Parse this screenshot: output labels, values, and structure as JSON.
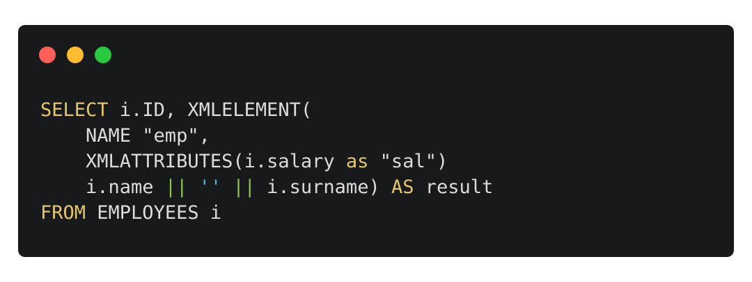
{
  "window": {
    "controls": [
      {
        "name": "close",
        "color": "#ff5f57"
      },
      {
        "name": "minimize",
        "color": "#febc2e"
      },
      {
        "name": "zoom",
        "color": "#28c840"
      }
    ]
  },
  "colors": {
    "background": "#18191b",
    "text": "#dcdcdc",
    "keyword": "#e5c76b",
    "operator": "#8bc34a",
    "string_literal": "#4fb3d9"
  },
  "code": {
    "lines": [
      [
        {
          "text": "SELECT",
          "type": "keyword"
        },
        {
          "text": " i.ID, XMLELEMENT(",
          "type": "text"
        }
      ],
      [
        {
          "text": "    NAME \"emp\",",
          "type": "text"
        }
      ],
      [
        {
          "text": "    XMLATTRIBUTES(i.salary ",
          "type": "text"
        },
        {
          "text": "as",
          "type": "keyword"
        },
        {
          "text": " \"sal\")",
          "type": "text"
        }
      ],
      [
        {
          "text": "    i.name ",
          "type": "text"
        },
        {
          "text": "||",
          "type": "operator"
        },
        {
          "text": " ",
          "type": "text"
        },
        {
          "text": "''",
          "type": "string_literal"
        },
        {
          "text": " ",
          "type": "text"
        },
        {
          "text": "||",
          "type": "operator"
        },
        {
          "text": " i.surname) ",
          "type": "text"
        },
        {
          "text": "AS",
          "type": "keyword"
        },
        {
          "text": " result",
          "type": "text"
        }
      ],
      [
        {
          "text": "FROM",
          "type": "keyword"
        },
        {
          "text": " EMPLOYEES i",
          "type": "text"
        }
      ]
    ]
  }
}
